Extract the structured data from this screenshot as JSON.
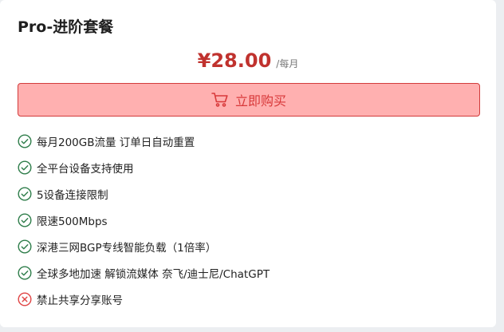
{
  "plan": {
    "title": "Pro-进阶套餐",
    "price": "¥28.00",
    "period": "/每月",
    "buy_label": "立即购买",
    "buy_icon": "cart-icon"
  },
  "features": [
    {
      "text": "每月200GB流量 订单日自动重置",
      "included": true
    },
    {
      "text": "全平台设备支持使用",
      "included": true
    },
    {
      "text": "5设备连接限制",
      "included": true
    },
    {
      "text": "限速500Mbps",
      "included": true
    },
    {
      "text": "深港三网BGP专线智能负载（1倍率）",
      "included": true
    },
    {
      "text": "全球多地加速 解锁流媒体 奈飞/迪士尼/ChatGPT",
      "included": true
    },
    {
      "text": "禁止共享分享账号",
      "included": false
    }
  ],
  "colors": {
    "accent": "#c0322e",
    "button_bg": "#ffb0b0",
    "button_border": "#d23b3b",
    "check": "#2e7d4a",
    "cross": "#e04444"
  }
}
